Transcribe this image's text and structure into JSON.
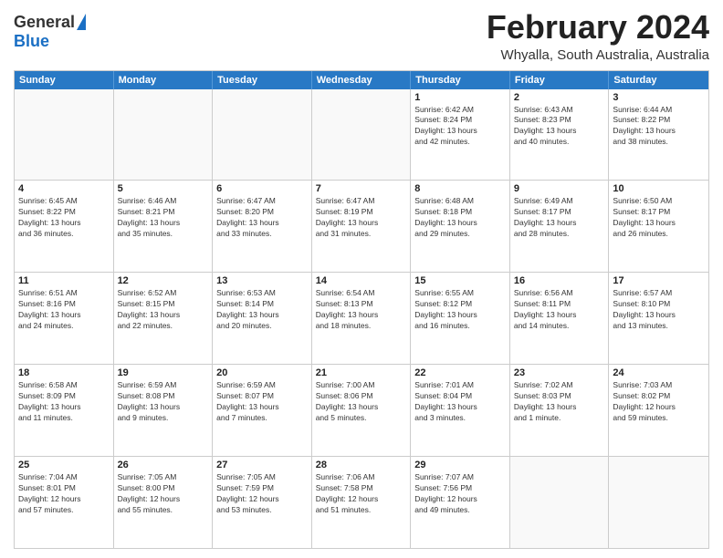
{
  "logo": {
    "general": "General",
    "blue": "Blue"
  },
  "title": "February 2024",
  "location": "Whyalla, South Australia, Australia",
  "days_of_week": [
    "Sunday",
    "Monday",
    "Tuesday",
    "Wednesday",
    "Thursday",
    "Friday",
    "Saturday"
  ],
  "weeks": [
    [
      {
        "day": "",
        "info": ""
      },
      {
        "day": "",
        "info": ""
      },
      {
        "day": "",
        "info": ""
      },
      {
        "day": "",
        "info": ""
      },
      {
        "day": "1",
        "info": "Sunrise: 6:42 AM\nSunset: 8:24 PM\nDaylight: 13 hours\nand 42 minutes."
      },
      {
        "day": "2",
        "info": "Sunrise: 6:43 AM\nSunset: 8:23 PM\nDaylight: 13 hours\nand 40 minutes."
      },
      {
        "day": "3",
        "info": "Sunrise: 6:44 AM\nSunset: 8:22 PM\nDaylight: 13 hours\nand 38 minutes."
      }
    ],
    [
      {
        "day": "4",
        "info": "Sunrise: 6:45 AM\nSunset: 8:22 PM\nDaylight: 13 hours\nand 36 minutes."
      },
      {
        "day": "5",
        "info": "Sunrise: 6:46 AM\nSunset: 8:21 PM\nDaylight: 13 hours\nand 35 minutes."
      },
      {
        "day": "6",
        "info": "Sunrise: 6:47 AM\nSunset: 8:20 PM\nDaylight: 13 hours\nand 33 minutes."
      },
      {
        "day": "7",
        "info": "Sunrise: 6:47 AM\nSunset: 8:19 PM\nDaylight: 13 hours\nand 31 minutes."
      },
      {
        "day": "8",
        "info": "Sunrise: 6:48 AM\nSunset: 8:18 PM\nDaylight: 13 hours\nand 29 minutes."
      },
      {
        "day": "9",
        "info": "Sunrise: 6:49 AM\nSunset: 8:17 PM\nDaylight: 13 hours\nand 28 minutes."
      },
      {
        "day": "10",
        "info": "Sunrise: 6:50 AM\nSunset: 8:17 PM\nDaylight: 13 hours\nand 26 minutes."
      }
    ],
    [
      {
        "day": "11",
        "info": "Sunrise: 6:51 AM\nSunset: 8:16 PM\nDaylight: 13 hours\nand 24 minutes."
      },
      {
        "day": "12",
        "info": "Sunrise: 6:52 AM\nSunset: 8:15 PM\nDaylight: 13 hours\nand 22 minutes."
      },
      {
        "day": "13",
        "info": "Sunrise: 6:53 AM\nSunset: 8:14 PM\nDaylight: 13 hours\nand 20 minutes."
      },
      {
        "day": "14",
        "info": "Sunrise: 6:54 AM\nSunset: 8:13 PM\nDaylight: 13 hours\nand 18 minutes."
      },
      {
        "day": "15",
        "info": "Sunrise: 6:55 AM\nSunset: 8:12 PM\nDaylight: 13 hours\nand 16 minutes."
      },
      {
        "day": "16",
        "info": "Sunrise: 6:56 AM\nSunset: 8:11 PM\nDaylight: 13 hours\nand 14 minutes."
      },
      {
        "day": "17",
        "info": "Sunrise: 6:57 AM\nSunset: 8:10 PM\nDaylight: 13 hours\nand 13 minutes."
      }
    ],
    [
      {
        "day": "18",
        "info": "Sunrise: 6:58 AM\nSunset: 8:09 PM\nDaylight: 13 hours\nand 11 minutes."
      },
      {
        "day": "19",
        "info": "Sunrise: 6:59 AM\nSunset: 8:08 PM\nDaylight: 13 hours\nand 9 minutes."
      },
      {
        "day": "20",
        "info": "Sunrise: 6:59 AM\nSunset: 8:07 PM\nDaylight: 13 hours\nand 7 minutes."
      },
      {
        "day": "21",
        "info": "Sunrise: 7:00 AM\nSunset: 8:06 PM\nDaylight: 13 hours\nand 5 minutes."
      },
      {
        "day": "22",
        "info": "Sunrise: 7:01 AM\nSunset: 8:04 PM\nDaylight: 13 hours\nand 3 minutes."
      },
      {
        "day": "23",
        "info": "Sunrise: 7:02 AM\nSunset: 8:03 PM\nDaylight: 13 hours\nand 1 minute."
      },
      {
        "day": "24",
        "info": "Sunrise: 7:03 AM\nSunset: 8:02 PM\nDaylight: 12 hours\nand 59 minutes."
      }
    ],
    [
      {
        "day": "25",
        "info": "Sunrise: 7:04 AM\nSunset: 8:01 PM\nDaylight: 12 hours\nand 57 minutes."
      },
      {
        "day": "26",
        "info": "Sunrise: 7:05 AM\nSunset: 8:00 PM\nDaylight: 12 hours\nand 55 minutes."
      },
      {
        "day": "27",
        "info": "Sunrise: 7:05 AM\nSunset: 7:59 PM\nDaylight: 12 hours\nand 53 minutes."
      },
      {
        "day": "28",
        "info": "Sunrise: 7:06 AM\nSunset: 7:58 PM\nDaylight: 12 hours\nand 51 minutes."
      },
      {
        "day": "29",
        "info": "Sunrise: 7:07 AM\nSunset: 7:56 PM\nDaylight: 12 hours\nand 49 minutes."
      },
      {
        "day": "",
        "info": ""
      },
      {
        "day": "",
        "info": ""
      }
    ]
  ]
}
